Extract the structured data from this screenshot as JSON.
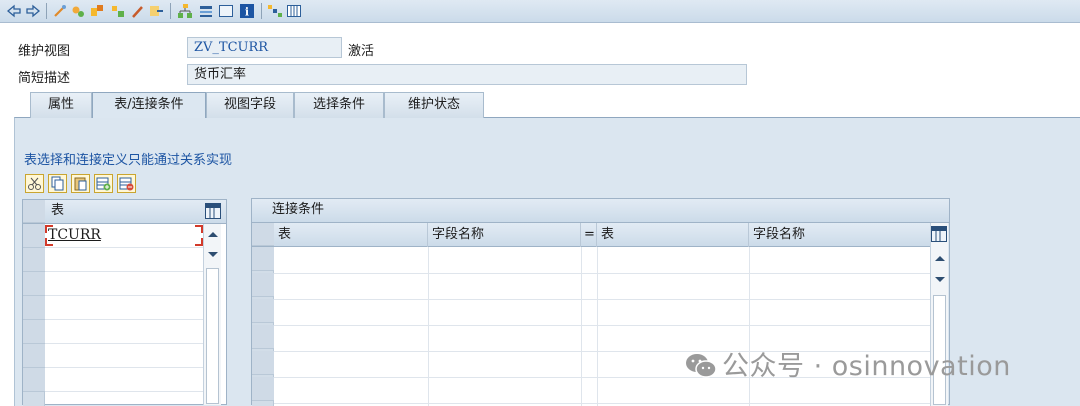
{
  "header": {
    "view_label": "维护视图",
    "view_value": "ZV_TCURR",
    "status": "激活",
    "desc_label": "简短描述",
    "desc_value": "货币汇率"
  },
  "tabs": [
    {
      "label": "属性",
      "active": false
    },
    {
      "label": "表/连接条件",
      "active": true
    },
    {
      "label": "视图字段",
      "active": false
    },
    {
      "label": "选择条件",
      "active": false
    },
    {
      "label": "维护状态",
      "active": false
    }
  ],
  "info_text": "表选择和连接定义只能通过关系实现",
  "tables_grid": {
    "header": "表",
    "rows": [
      "TCURR",
      "",
      "",
      "",
      "",
      "",
      ""
    ]
  },
  "join_grid": {
    "title": "连接条件",
    "columns": [
      "表",
      "字段名称",
      "=",
      "表",
      "字段名称"
    ],
    "rows": 6
  },
  "watermark": "公众号 · osinnovation",
  "icons": {
    "toolbar": [
      "back-icon",
      "forward-icon",
      "other-object-icon",
      "display-change-icon",
      "activate-icon",
      "where-used-icon",
      "object-list-icon",
      "check-icon",
      "hierarchy-icon",
      "layout-icon",
      "info-icon",
      "tree-icon",
      "table-icon"
    ],
    "mini_toolbar": [
      "cut-icon",
      "copy-icon",
      "paste-icon",
      "insert-row-icon",
      "delete-row-icon"
    ]
  },
  "colors": {
    "accent": "#1d55a3",
    "panel": "#dbe6f0",
    "highlight": "#d2b25a"
  }
}
